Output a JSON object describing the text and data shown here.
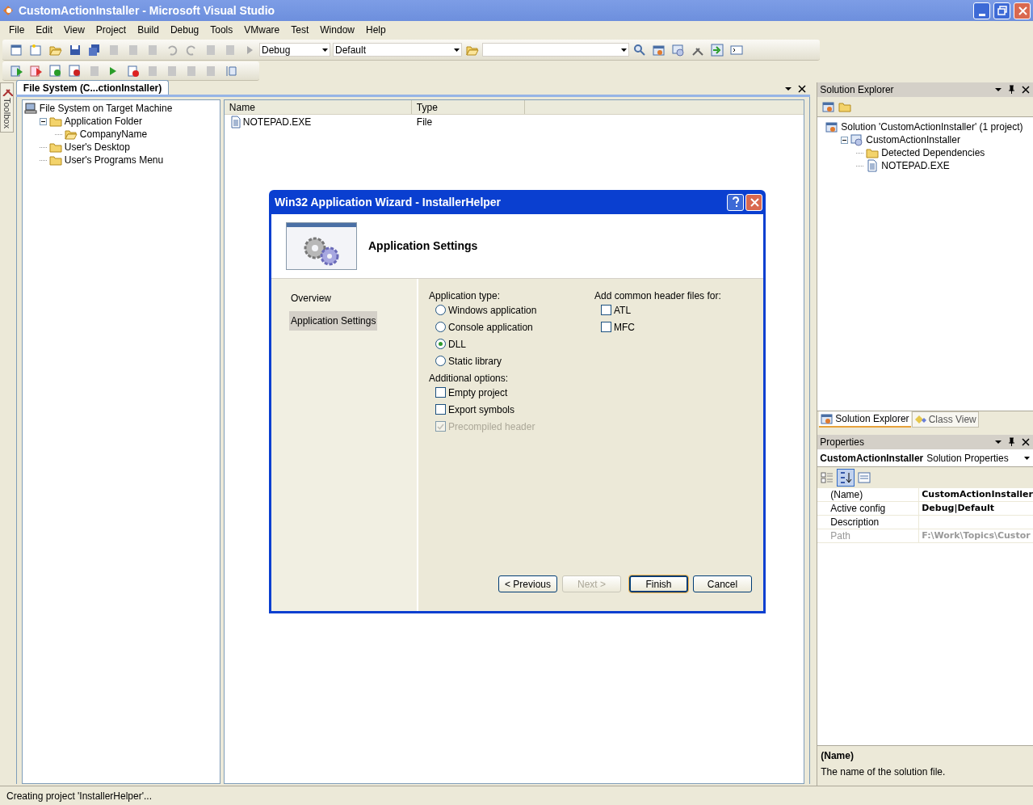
{
  "window": {
    "title": "CustomActionInstaller - Microsoft Visual Studio"
  },
  "menu": [
    "File",
    "Edit",
    "View",
    "Project",
    "Build",
    "Debug",
    "Tools",
    "VMware",
    "Test",
    "Window",
    "Help"
  ],
  "toolbar": {
    "configuration": "Debug",
    "platform": "Default"
  },
  "toolbox_tab": "Toolbox",
  "document_tab": {
    "label": "File System (C...ctionInstaller)",
    "selected": true
  },
  "file_system_tree": [
    {
      "label": "File System on Target Machine",
      "kind": "machine",
      "children": [
        {
          "label": "Application Folder",
          "kind": "folder",
          "expanded": true,
          "children": [
            {
              "label": "CompanyName",
              "kind": "open-folder"
            }
          ]
        },
        {
          "label": "User's Desktop",
          "kind": "folder"
        },
        {
          "label": "User's Programs Menu",
          "kind": "folder"
        }
      ]
    }
  ],
  "file_list": {
    "columns": [
      "Name",
      "Type"
    ],
    "rows": [
      {
        "name": "NOTEPAD.EXE",
        "type": "File"
      }
    ]
  },
  "dialog": {
    "title": "Win32 Application Wizard - InstallerHelper",
    "heading": "Application Settings",
    "nav": [
      {
        "label": "Overview",
        "selected": false
      },
      {
        "label": "Application Settings",
        "selected": true
      }
    ],
    "application_type": {
      "label": "Application type:",
      "options": [
        {
          "label": "Windows application",
          "selected": false
        },
        {
          "label": "Console application",
          "selected": false
        },
        {
          "label": "DLL",
          "selected": true
        },
        {
          "label": "Static library",
          "selected": false
        }
      ]
    },
    "additional_options": {
      "label": "Additional options:",
      "options": [
        {
          "label": "Empty project",
          "checked": false,
          "disabled": false
        },
        {
          "label": "Export symbols",
          "checked": false,
          "disabled": false
        },
        {
          "label": "Precompiled header",
          "checked": true,
          "disabled": true
        }
      ]
    },
    "header_files": {
      "label": "Add common header files for:",
      "options": [
        {
          "label": "ATL",
          "checked": false,
          "disabled": false
        },
        {
          "label": "MFC",
          "checked": false,
          "disabled": false
        }
      ]
    },
    "buttons": [
      {
        "label": "< Previous",
        "disabled": false,
        "default": false
      },
      {
        "label": "Next >",
        "disabled": true,
        "default": false
      },
      {
        "label": "Finish",
        "disabled": false,
        "default": true
      },
      {
        "label": "Cancel",
        "disabled": false,
        "default": false
      }
    ]
  },
  "solution_explorer": {
    "title": "Solution Explorer",
    "tree": [
      {
        "label": "Solution 'CustomActionInstaller' (1 project)",
        "kind": "solution",
        "children": [
          {
            "label": "CustomActionInstaller",
            "kind": "project",
            "expanded": true,
            "children": [
              {
                "label": "Detected Dependencies",
                "kind": "folder"
              },
              {
                "label": "NOTEPAD.EXE",
                "kind": "file"
              }
            ]
          }
        ]
      }
    ]
  },
  "panel_tabs": [
    {
      "label": "Solution Explorer",
      "selected": true
    },
    {
      "label": "Class View",
      "selected": false
    }
  ],
  "properties": {
    "title": "Properties",
    "object_name": "CustomActionInstaller",
    "object_type": "Solution Properties",
    "rows": [
      {
        "name": "(Name)",
        "value": "CustomActionInstaller",
        "disabled": false
      },
      {
        "name": "Active config",
        "value": "Debug|Default",
        "disabled": false
      },
      {
        "name": "Description",
        "value": "",
        "disabled": false
      },
      {
        "name": "Path",
        "value": "F:\\Work\\Topics\\Custor",
        "disabled": true
      }
    ],
    "description_title": "(Name)",
    "description": "The name of the solution file."
  },
  "status_bar": "Creating project 'InstallerHelper'..."
}
